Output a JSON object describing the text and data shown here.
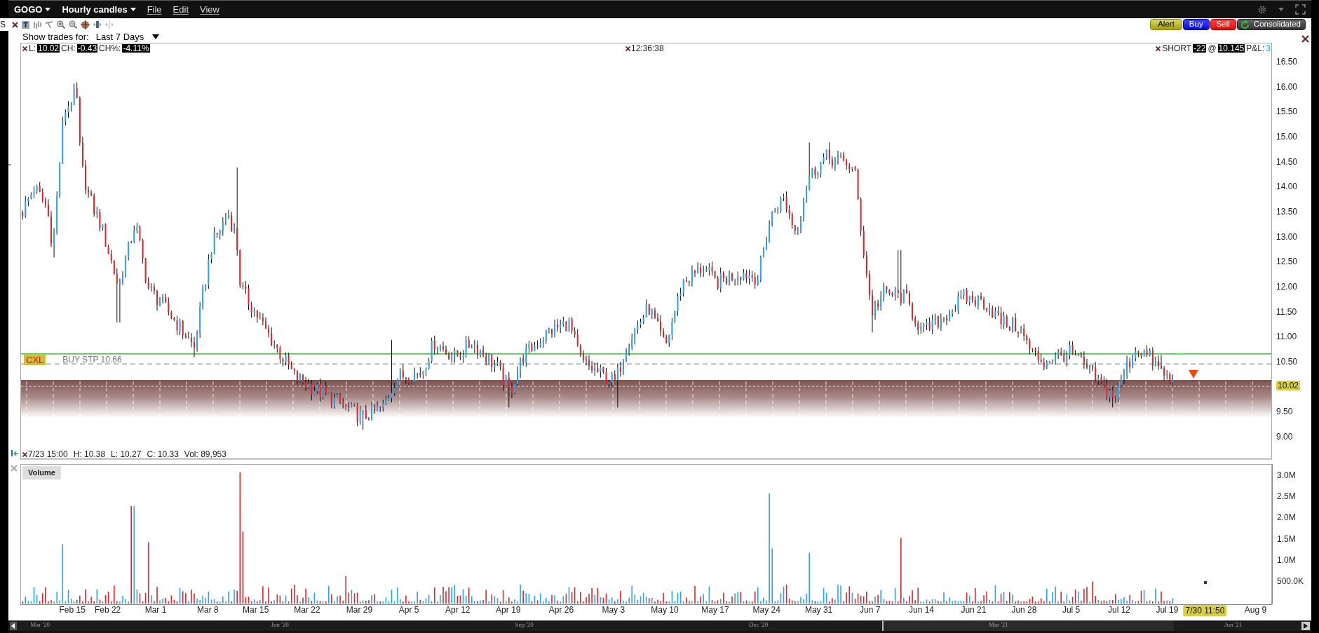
{
  "background_text": "S",
  "title_bar": {
    "symbol": "GOGO",
    "chart_type": "Hourly candles",
    "menu": [
      "File",
      "Edit",
      "View"
    ]
  },
  "order_buttons": [
    {
      "kind": "alert",
      "label": "Alert"
    },
    {
      "kind": "buy",
      "label": "Buy"
    },
    {
      "kind": "sell",
      "label": "Sell"
    },
    {
      "kind": "exchange",
      "label": "Consolidated"
    }
  ],
  "trades_filter": {
    "label": "Show trades for:",
    "value": "Last 7 Days"
  },
  "quote": [
    {
      "label": "L:",
      "value": "10.02"
    },
    {
      "label": "CH:",
      "value": "-0.43"
    },
    {
      "label": "CH%:",
      "value": "-4.11%"
    }
  ],
  "clock": "12:36:38",
  "position": {
    "side": "SHORT",
    "quantity": "-22",
    "at": "@",
    "price": "10.145",
    "pnl_label": "P&L:",
    "pnl": "3"
  },
  "order_line": {
    "tag": "CXL",
    "label": "BUY STP 10.66"
  },
  "price_axis": [
    "16.50",
    "16.00",
    "15.50",
    "15.00",
    "14.50",
    "14.00",
    "13.50",
    "13.00",
    "12.50",
    "12.00",
    "11.50",
    "11.00",
    "10.50",
    "9.50",
    "9.00"
  ],
  "last_price": "10.02",
  "bar_info": [
    "7/23 15:00",
    "H: 10.38",
    "L: 10.27",
    "C: 10.33",
    "Vol: 89,953"
  ],
  "volume": {
    "title": "Volume",
    "axis": [
      "3.0M",
      "2.5M",
      "2.0M",
      "1.5M",
      "1.0M",
      "500.0K"
    ]
  },
  "date_axis": [
    {
      "kind": "tick",
      "label": "Feb 15"
    },
    {
      "kind": "tick",
      "label": "Feb 22"
    },
    {
      "kind": "tick",
      "label": "Mar 1"
    },
    {
      "kind": "tick",
      "label": "Mar 8"
    },
    {
      "kind": "tick",
      "label": "Mar 15"
    },
    {
      "kind": "tick",
      "label": "Mar 22"
    },
    {
      "kind": "tick",
      "label": "Mar 29"
    },
    {
      "kind": "tick",
      "label": "Apr 5"
    },
    {
      "kind": "tick",
      "label": "Apr 12"
    },
    {
      "kind": "tick",
      "label": "Apr 19"
    },
    {
      "kind": "tick",
      "label": "Apr 26"
    },
    {
      "kind": "tick",
      "label": "May 3"
    },
    {
      "kind": "tick",
      "label": "May 10"
    },
    {
      "kind": "tick",
      "label": "May 17"
    },
    {
      "kind": "tick",
      "label": "May 24"
    },
    {
      "kind": "tick",
      "label": "May 31"
    },
    {
      "kind": "tick",
      "label": "Jun 7"
    },
    {
      "kind": "tick",
      "label": "Jun 14"
    },
    {
      "kind": "tick",
      "label": "Jun 21"
    },
    {
      "kind": "tick",
      "label": "Jun 28"
    },
    {
      "kind": "tick",
      "label": "Jul 5"
    },
    {
      "kind": "tick",
      "label": "Jul 12"
    },
    {
      "kind": "tick",
      "label": "Jul 19"
    },
    {
      "kind": "cursor",
      "label": "7/30 11:50"
    },
    {
      "kind": "tick",
      "label": "Aug 9"
    }
  ],
  "scrollbar": {
    "labels": [
      "Mar '20",
      "Jun '20",
      "Sep '20",
      "Dec '20",
      "Mar '21",
      "Jun '21"
    ]
  }
}
